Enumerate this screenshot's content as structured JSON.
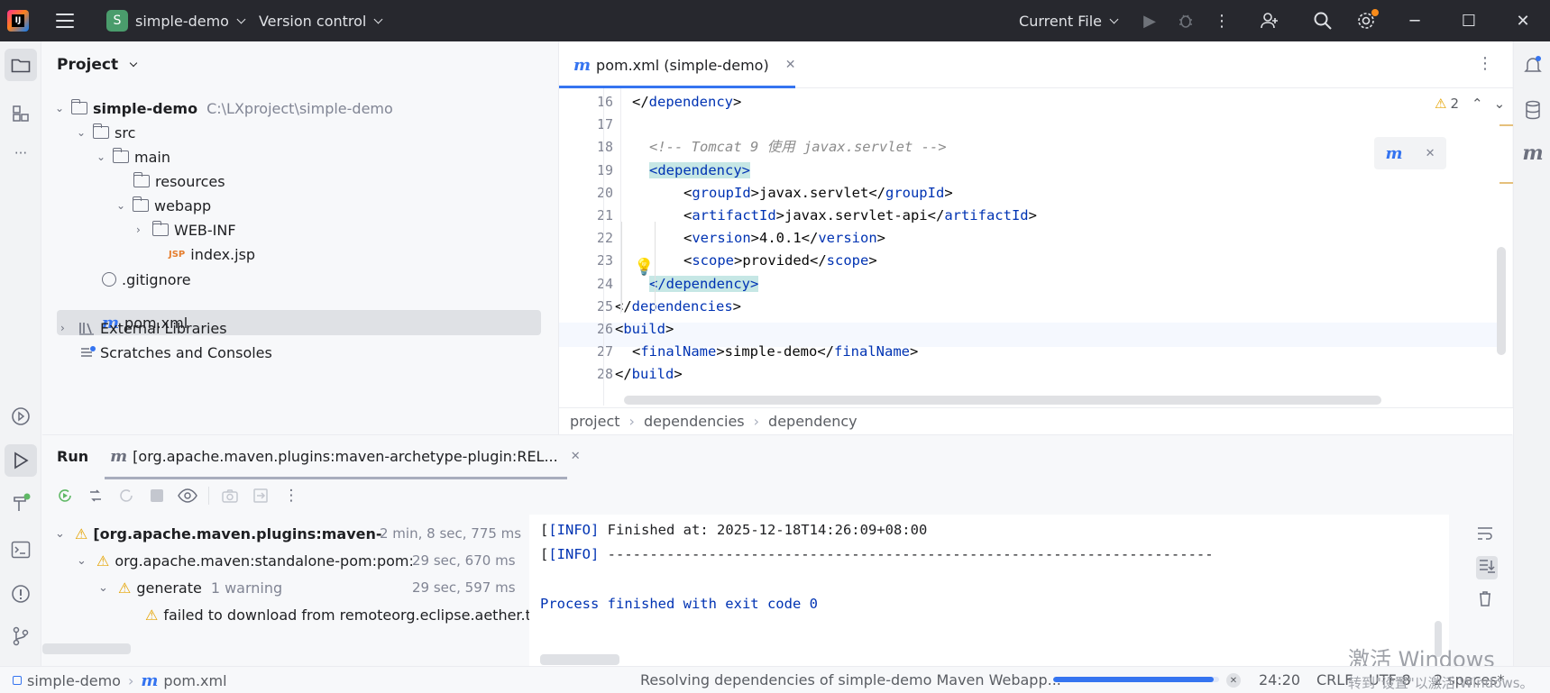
{
  "titlebar": {
    "project_initial": "S",
    "project_name": "simple-demo",
    "vcs": "Version control",
    "run_config": "Current File",
    "logo_text": "IJ"
  },
  "project_panel": {
    "title": "Project",
    "tree": [
      {
        "label": "simple-demo",
        "path": "C:\\LXproject\\simple-demo"
      },
      {
        "label": "src"
      },
      {
        "label": "main"
      },
      {
        "label": "resources"
      },
      {
        "label": "webapp"
      },
      {
        "label": "WEB-INF"
      },
      {
        "label": "index.jsp",
        "icon_text": "JSP"
      },
      {
        "label": ".gitignore"
      },
      {
        "label": "pom.xml"
      },
      {
        "label": "External Libraries"
      },
      {
        "label": "Scratches and Consoles"
      }
    ]
  },
  "editor": {
    "tab_label": "pom.xml (simple-demo)",
    "warnings_count": "2",
    "lines": [
      {
        "no": "16",
        "parts": [
          [
            "t",
            "</"
          ],
          [
            "k",
            "dependency"
          ],
          [
            "t",
            ">"
          ]
        ]
      },
      {
        "no": "17",
        "parts": []
      },
      {
        "no": "18",
        "parts": [
          [
            "c",
            "<!-- Tomcat 9 使用 javax.servlet -->"
          ]
        ]
      },
      {
        "no": "19",
        "parts": [
          [
            "h",
            "<dependency>"
          ]
        ]
      },
      {
        "no": "20",
        "parts": [
          [
            "t",
            "<"
          ],
          [
            "k",
            "groupId"
          ],
          [
            "t",
            ">javax.servlet</"
          ],
          [
            "k",
            "groupId"
          ],
          [
            "t",
            ">"
          ]
        ]
      },
      {
        "no": "21",
        "parts": [
          [
            "t",
            "<"
          ],
          [
            "k",
            "artifactId"
          ],
          [
            "t",
            ">javax.servlet-api</"
          ],
          [
            "k",
            "artifactId"
          ],
          [
            "t",
            ">"
          ]
        ]
      },
      {
        "no": "22",
        "parts": [
          [
            "t",
            "<"
          ],
          [
            "k",
            "version"
          ],
          [
            "t",
            ">4.0.1</"
          ],
          [
            "k",
            "version"
          ],
          [
            "t",
            ">"
          ]
        ]
      },
      {
        "no": "23",
        "parts": [
          [
            "t",
            "<"
          ],
          [
            "k",
            "scope"
          ],
          [
            "t",
            ">provided</"
          ],
          [
            "k",
            "scope"
          ],
          [
            "t",
            ">"
          ]
        ]
      },
      {
        "no": "24",
        "parts": [
          [
            "h",
            "</dependency>"
          ]
        ]
      },
      {
        "no": "25",
        "parts": [
          [
            "t",
            "</"
          ],
          [
            "k",
            "dependencies"
          ],
          [
            "t",
            ">"
          ]
        ]
      },
      {
        "no": "26",
        "parts": [
          [
            "t",
            "<"
          ],
          [
            "k",
            "build"
          ],
          [
            "t",
            ">"
          ]
        ]
      },
      {
        "no": "27",
        "parts": [
          [
            "t",
            "<"
          ],
          [
            "k",
            "finalName"
          ],
          [
            "t",
            ">simple-demo</"
          ],
          [
            "k",
            "finalName"
          ],
          [
            "t",
            ">"
          ]
        ]
      },
      {
        "no": "28",
        "parts": [
          [
            "t",
            "</"
          ],
          [
            "k",
            "build"
          ],
          [
            "t",
            ">"
          ]
        ]
      }
    ],
    "breadcrumb": [
      "project",
      "dependencies",
      "dependency"
    ]
  },
  "run_panel": {
    "title": "Run",
    "tab_label": "[org.apache.maven.plugins:maven-archetype-plugin:REL...",
    "tree": [
      {
        "label": "[org.apache.maven.plugins:maven-",
        "time": "2 min, 8 sec, 775 ms"
      },
      {
        "label": "org.apache.maven:standalone-pom:pom:",
        "time": "29 sec, 670 ms"
      },
      {
        "label": "generate",
        "note": "1 warning",
        "time": "29 sec, 597 ms"
      },
      {
        "label": "failed to download from remoteorg.eclipse.aether.tra"
      }
    ],
    "console": [
      {
        "prefix": "[INFO]",
        "text": " Finished at: 2025-12-18T14:26:09+08:00"
      },
      {
        "prefix": "[INFO]",
        "text": " ------------------------------------------------------------------------"
      },
      {
        "text": "Process finished with exit code 0"
      }
    ]
  },
  "statusbar": {
    "project": "simple-demo",
    "file": "pom.xml",
    "task": "Resolving dependencies of simple-demo Maven Webapp...",
    "progress": 0.97,
    "position": "24:20",
    "line_sep": "CRLF",
    "encoding": "UTF-8",
    "indent": "2 spaces*"
  },
  "watermark": {
    "line1": "激活 Windows",
    "line2": "转到\"设置\"以激活 Windows。"
  },
  "colors": {
    "accent": "#3574f0",
    "titlebar_bg": "#27282e",
    "warning": "#e5a300",
    "xml_tag": "#0033b3",
    "highlight": "#c6e7e5"
  }
}
